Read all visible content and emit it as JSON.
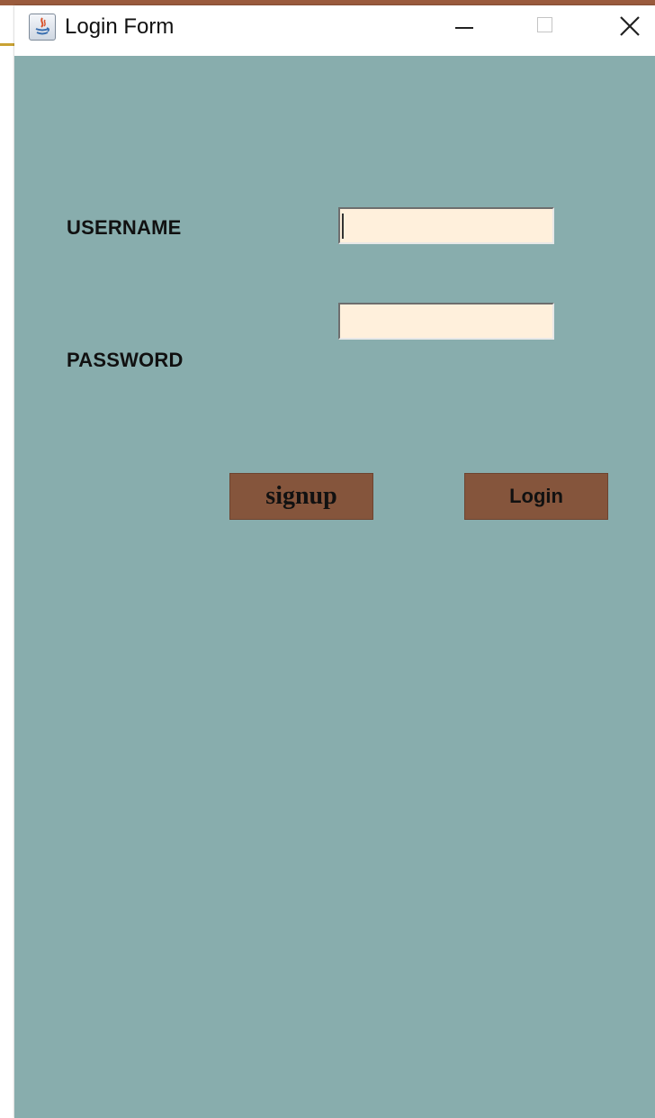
{
  "window": {
    "title": "Login Form",
    "icon": "java-icon",
    "controls": {
      "minimize": "minimize-icon",
      "maximize": "maximize-icon",
      "close": "close-icon"
    }
  },
  "form": {
    "username_label": "USERNAME",
    "username_value": "",
    "password_label": "PASSWORD",
    "password_value": "",
    "signup_label": "signup",
    "login_label": "Login"
  },
  "colors": {
    "panel_background": "#88adad",
    "field_background": "#fff0dc",
    "button_background": "#85553c"
  }
}
